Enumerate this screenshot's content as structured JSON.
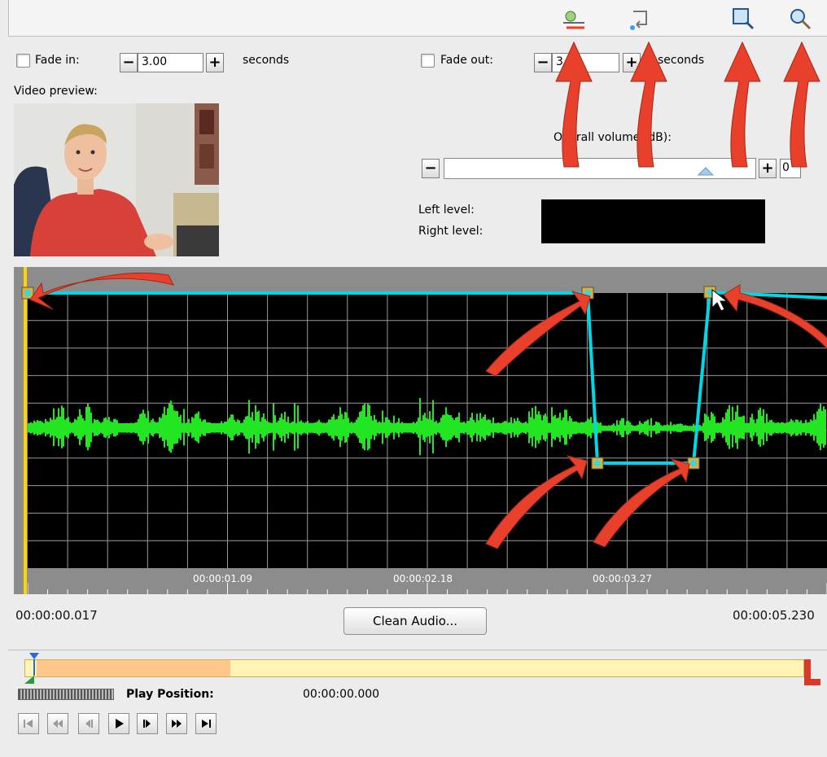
{
  "toolbar": {
    "icons": [
      "volume-keyframe-icon",
      "undo-icon",
      "zoom-in-icon",
      "zoom-out-icon"
    ]
  },
  "fade_in": {
    "label": "Fade in:",
    "value": "3.00",
    "unit": "seconds"
  },
  "fade_out": {
    "label": "Fade out:",
    "value": "3.00",
    "unit": "seconds"
  },
  "video_preview_label": "Video preview:",
  "volume": {
    "label": "Overall volume (dB):",
    "value": "0",
    "level": 0.84
  },
  "levels": {
    "left": "Left level:",
    "right": "Right level:"
  },
  "timeline": {
    "ticks": [
      "00:00:01.09",
      "00:00:02.18",
      "00:00:03.27"
    ],
    "start": "00:00:00.017",
    "end": "00:00:05.230"
  },
  "clean_audio_label": "Clean Audio...",
  "play_position": {
    "label": "Play Position:",
    "value": "00:00:00.000"
  },
  "transport": [
    "go-to-start-icon",
    "rewind-icon",
    "step-back-icon",
    "play-icon",
    "step-forward-icon",
    "fast-forward-icon",
    "go-to-end-icon"
  ],
  "colors": {
    "waveform": "#22e622",
    "envelope": "#00d8e8",
    "playhead": "#ffd400",
    "annotation": "#e8402a"
  }
}
